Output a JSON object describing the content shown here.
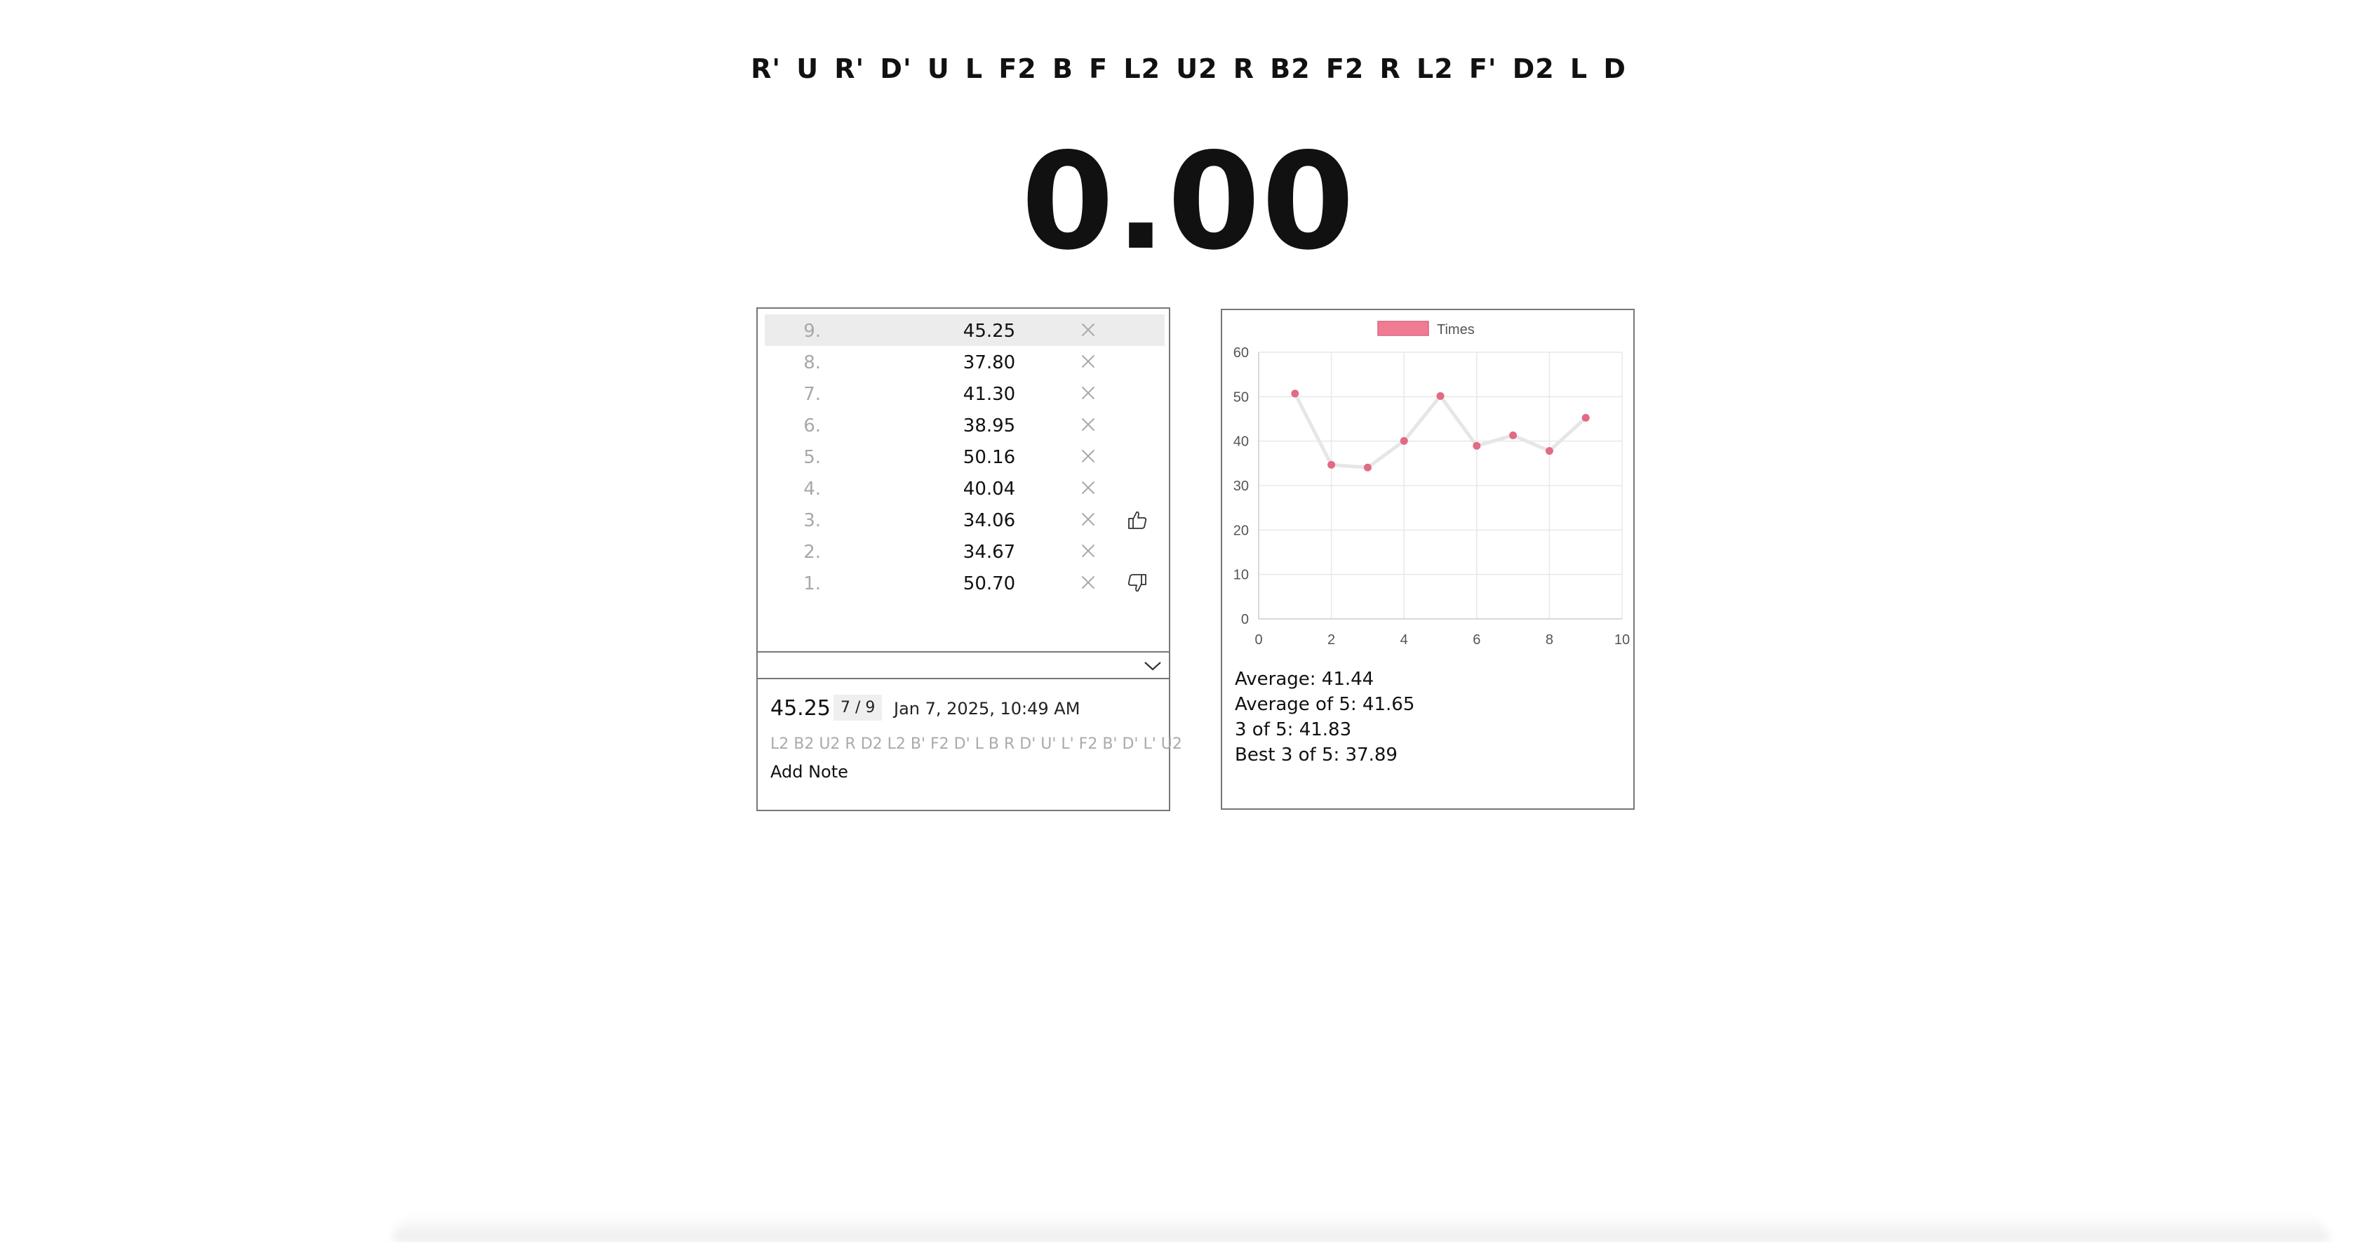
{
  "scramble": "R' U R' D' U L F2 B F L2 U2 R B2 F2 R L2 F' D2 L D",
  "timer": "0.00",
  "times": [
    {
      "index": "9.",
      "value": "45.25",
      "mark": "",
      "selected": true
    },
    {
      "index": "8.",
      "value": "37.80",
      "mark": "",
      "selected": false
    },
    {
      "index": "7.",
      "value": "41.30",
      "mark": "",
      "selected": false
    },
    {
      "index": "6.",
      "value": "38.95",
      "mark": "",
      "selected": false
    },
    {
      "index": "5.",
      "value": "50.16",
      "mark": "",
      "selected": false
    },
    {
      "index": "4.",
      "value": "40.04",
      "mark": "",
      "selected": false
    },
    {
      "index": "3.",
      "value": "34.06",
      "mark": "thumbs-up-icon",
      "selected": false
    },
    {
      "index": "2.",
      "value": "34.67",
      "mark": "",
      "selected": false
    },
    {
      "index": "1.",
      "value": "50.70",
      "mark": "thumbs-down-icon",
      "selected": false
    }
  ],
  "detail": {
    "time": "45.25",
    "rank": "7 / 9",
    "date": "Jan 7, 2025, 10:49 AM",
    "scramble": "L2 B2 U2 R D2 L2 B' F2 D' L B R D' U' L' F2 B' D' L' U2",
    "note_label": "Add Note"
  },
  "stats": {
    "average": "Average: 41.44",
    "avg5": "Average of 5: 41.65",
    "three_of_five": "3 of 5: 41.83",
    "best3of5": "Best 3 of 5: 37.89"
  },
  "chart_data": {
    "type": "line",
    "x": [
      1,
      2,
      3,
      4,
      5,
      6,
      7,
      8,
      9
    ],
    "series": [
      {
        "name": "Times",
        "values": [
          50.7,
          34.67,
          34.06,
          40.04,
          50.16,
          38.95,
          41.3,
          37.8,
          45.25
        ]
      }
    ],
    "xlim": [
      0,
      10
    ],
    "ylim": [
      0,
      60
    ],
    "xticks": [
      "0",
      "2",
      "4",
      "6",
      "8",
      "10"
    ],
    "yticks": [
      "0",
      "10",
      "20",
      "30",
      "40",
      "50",
      "60"
    ],
    "grid": true,
    "legend": "top-center",
    "colors": {
      "point": "#e26a85",
      "legend_fill": "#f07b93",
      "line": "#e6e6e6",
      "grid": "#e8e8e8"
    }
  }
}
